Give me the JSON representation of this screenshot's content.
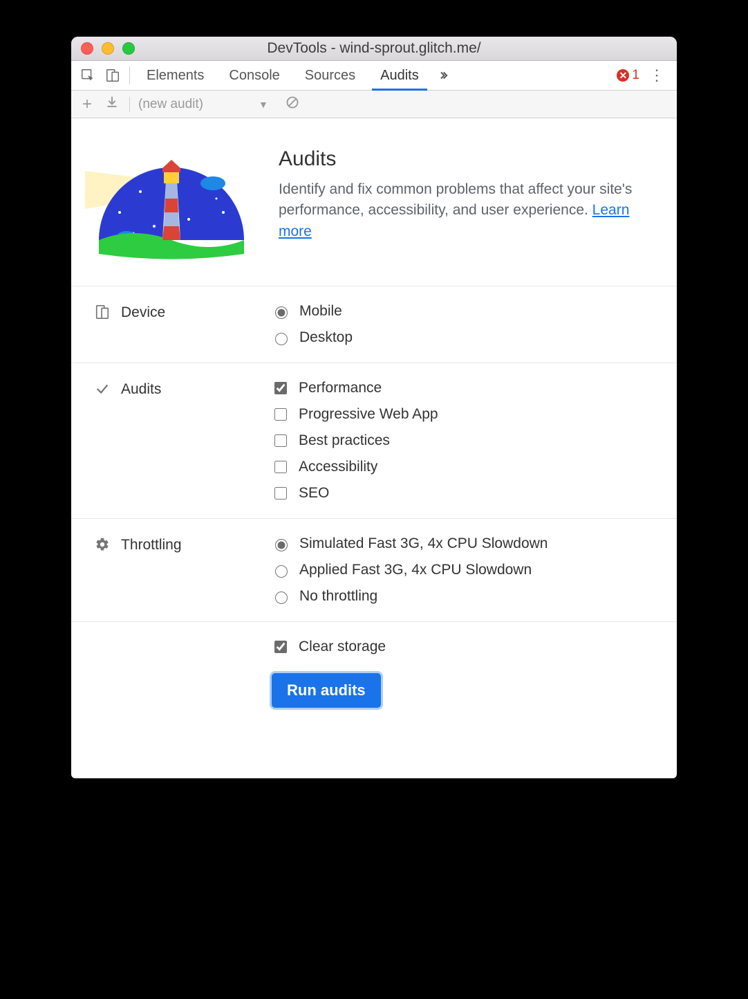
{
  "window": {
    "title": "DevTools - wind-sprout.glitch.me/"
  },
  "tabs": {
    "items": [
      "Elements",
      "Console",
      "Sources",
      "Audits"
    ],
    "active_index": 3,
    "errors_count": "1"
  },
  "toolbar": {
    "audit_selector": "(new audit)"
  },
  "hero": {
    "title": "Audits",
    "description_prefix": "Identify and fix common problems that affect your site's performance, accessibility, and user experience. ",
    "learn_more": "Learn more"
  },
  "sections": {
    "device": {
      "label": "Device",
      "options": [
        {
          "label": "Mobile",
          "checked": true
        },
        {
          "label": "Desktop",
          "checked": false
        }
      ]
    },
    "audits": {
      "label": "Audits",
      "options": [
        {
          "label": "Performance",
          "checked": true
        },
        {
          "label": "Progressive Web App",
          "checked": false
        },
        {
          "label": "Best practices",
          "checked": false
        },
        {
          "label": "Accessibility",
          "checked": false
        },
        {
          "label": "SEO",
          "checked": false
        }
      ]
    },
    "throttling": {
      "label": "Throttling",
      "options": [
        {
          "label": "Simulated Fast 3G, 4x CPU Slowdown",
          "checked": true
        },
        {
          "label": "Applied Fast 3G, 4x CPU Slowdown",
          "checked": false
        },
        {
          "label": "No throttling",
          "checked": false
        }
      ]
    }
  },
  "footer": {
    "clear_storage_label": "Clear storage",
    "clear_storage_checked": true,
    "run_button": "Run audits"
  }
}
